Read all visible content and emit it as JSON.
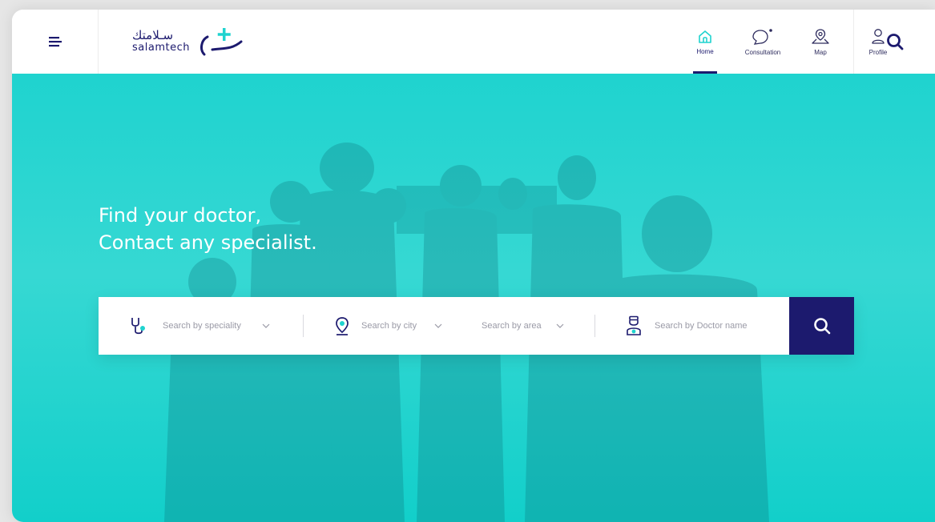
{
  "brand": {
    "name_ar": "سـلامتك",
    "name_en": "salamtech"
  },
  "header": {
    "nav": [
      {
        "label": "Home",
        "icon": "home-icon",
        "active": true
      },
      {
        "label": "Consultation",
        "icon": "chat-bubble-icon",
        "active": false
      },
      {
        "label": "Map",
        "icon": "map-pin-icon",
        "active": false
      },
      {
        "label": "Profile",
        "icon": "user-icon",
        "active": false
      }
    ]
  },
  "hero": {
    "title_line1": "Find your doctor,",
    "title_line2": "Contact any specialist."
  },
  "search": {
    "speciality": "Search by speciality",
    "city": "Search by city",
    "area": "Search by area",
    "doctor": "Search by Doctor name"
  },
  "colors": {
    "primary": "#1c1a6e",
    "accent": "#1fd3cf",
    "background": "#ffffff"
  }
}
